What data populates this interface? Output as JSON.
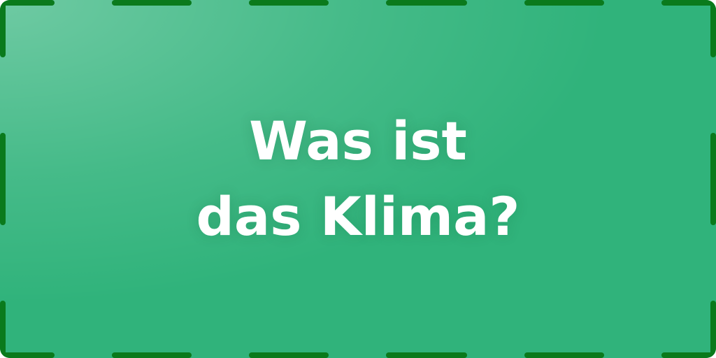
{
  "title": {
    "line1": "Was ist",
    "line2": "das Klima?"
  },
  "colors": {
    "background": "#30b37b",
    "border_dash": "#0a7a1c",
    "text": "#ffffff"
  }
}
